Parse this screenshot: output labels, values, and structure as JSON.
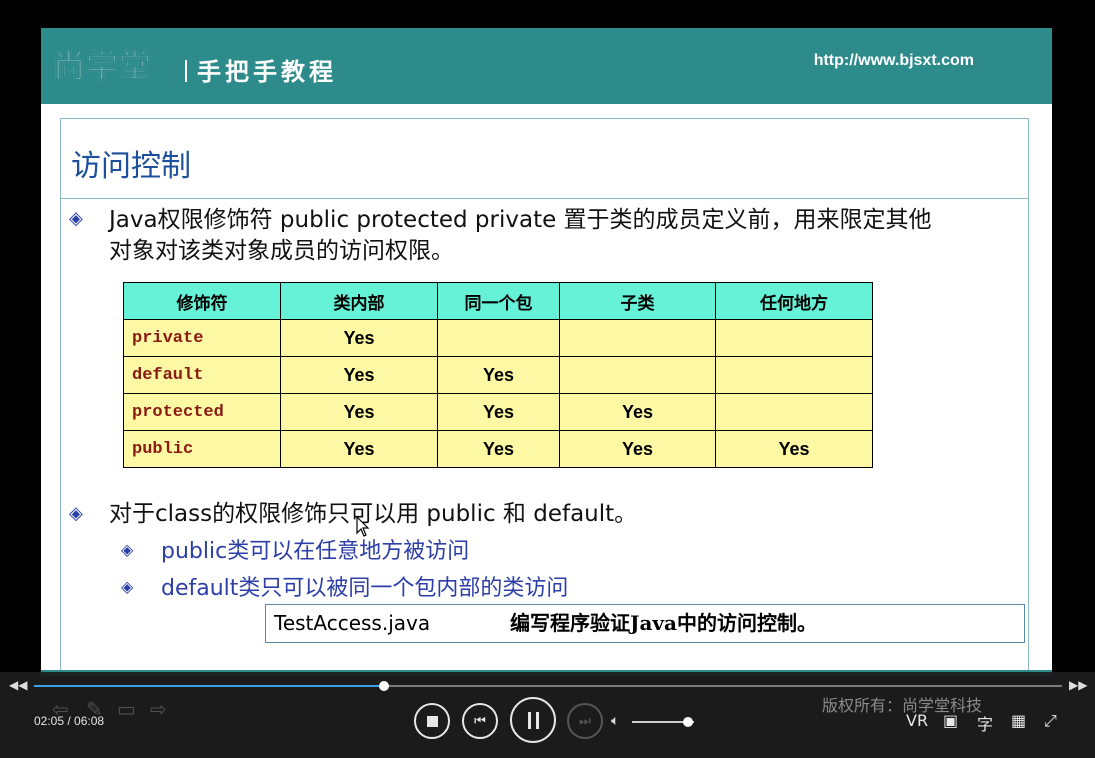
{
  "header": {
    "logo": "尚学堂",
    "tagline": "手把手教程",
    "url": "http://www.bjsxt.com"
  },
  "slide": {
    "title": "访问控制",
    "bullet1_line1": "Java权限修饰符 public protected private 置于类的成员定义前，用来限定其他",
    "bullet1_line2": "对象对该类对象成员的访问权限。",
    "table": {
      "headers": [
        "修饰符",
        "类内部",
        "同一个包",
        "子类",
        "任何地方"
      ],
      "rows": [
        [
          "private",
          "Yes",
          "",
          "",
          ""
        ],
        [
          "default",
          "Yes",
          "Yes",
          "",
          ""
        ],
        [
          "protected",
          "Yes",
          "Yes",
          "Yes",
          ""
        ],
        [
          "public",
          "Yes",
          "Yes",
          "Yes",
          "Yes"
        ]
      ]
    },
    "bullet2": "对于class的权限修饰只可以用 public 和 default。",
    "sub1": "public类可以在任意地方被访问",
    "sub2": "default类只可以被同一个包内部的类访问",
    "note_file": "TestAccess.java",
    "note_desc": "编写程序验证Java中的访问控制。"
  },
  "player": {
    "current_time": "02:05",
    "total_time": "06:08",
    "time_label": "02:05 / 06:08",
    "progress": 0.34,
    "volume": 0.9,
    "copyright": "版权所有：尚学堂科技",
    "vr_label": "VR",
    "subtitle_label": "字"
  },
  "colors": {
    "header_bg": "#2e8b8b",
    "title_color": "#1d4f9c",
    "table_header_bg": "#66f2d6",
    "table_cell_bg": "#fcf8a4",
    "modifier_color": "#8a1a12",
    "progress_color": "#3aa0e8"
  }
}
